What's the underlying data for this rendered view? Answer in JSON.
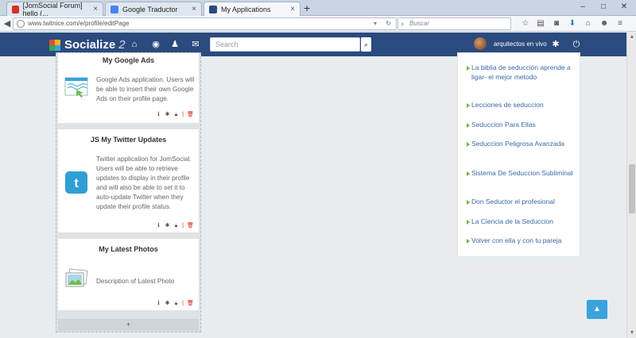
{
  "browser": {
    "tabs": [
      {
        "label": "[JomSocial Forum] hello (...",
        "favicon_color": "#d93025"
      },
      {
        "label": "Google Traductor",
        "favicon_color": "#4285f4"
      },
      {
        "label": "My Applications",
        "favicon_color": "#2b4a7e"
      }
    ],
    "new_tab": "+",
    "url": "www.twitnice.com/e/profile/editPage",
    "search_placeholder": "Buscar"
  },
  "site": {
    "logo_text": "Socialize",
    "logo_version": "2",
    "search_placeholder": "Search",
    "username": "arquitectos en vivo",
    "logo_colors": [
      "#e84a36",
      "#f7b519",
      "#36a852",
      "#3aa2dc"
    ]
  },
  "apps": [
    {
      "title": "My Google Ads",
      "description": "Google Ads application. Users will be able to insert their own Google Ads on their profile page."
    },
    {
      "title": "JS My Twitter Updates",
      "description": "Twitter application for JomSocial. Users will be able to retrieve updates to display in their profile and will also be able to set it to auto-update Twitter when they update their profile status."
    },
    {
      "title": "My Latest Photos",
      "description": "Description of Latest Photo"
    }
  ],
  "add_label": "+",
  "sidebar_links": [
    "La biblia de seducción aprende a ligar- el mejor metodo",
    "Lecciones de seduccion",
    "Seduccion Para Ellas",
    "Seduccion Peligrosa Avanzada",
    "Sistema De Seduccion Subliminal",
    "Don Seductor el profesional",
    "La Ciencia de la Seduccion",
    "Volver con ella y con tu pareja"
  ]
}
